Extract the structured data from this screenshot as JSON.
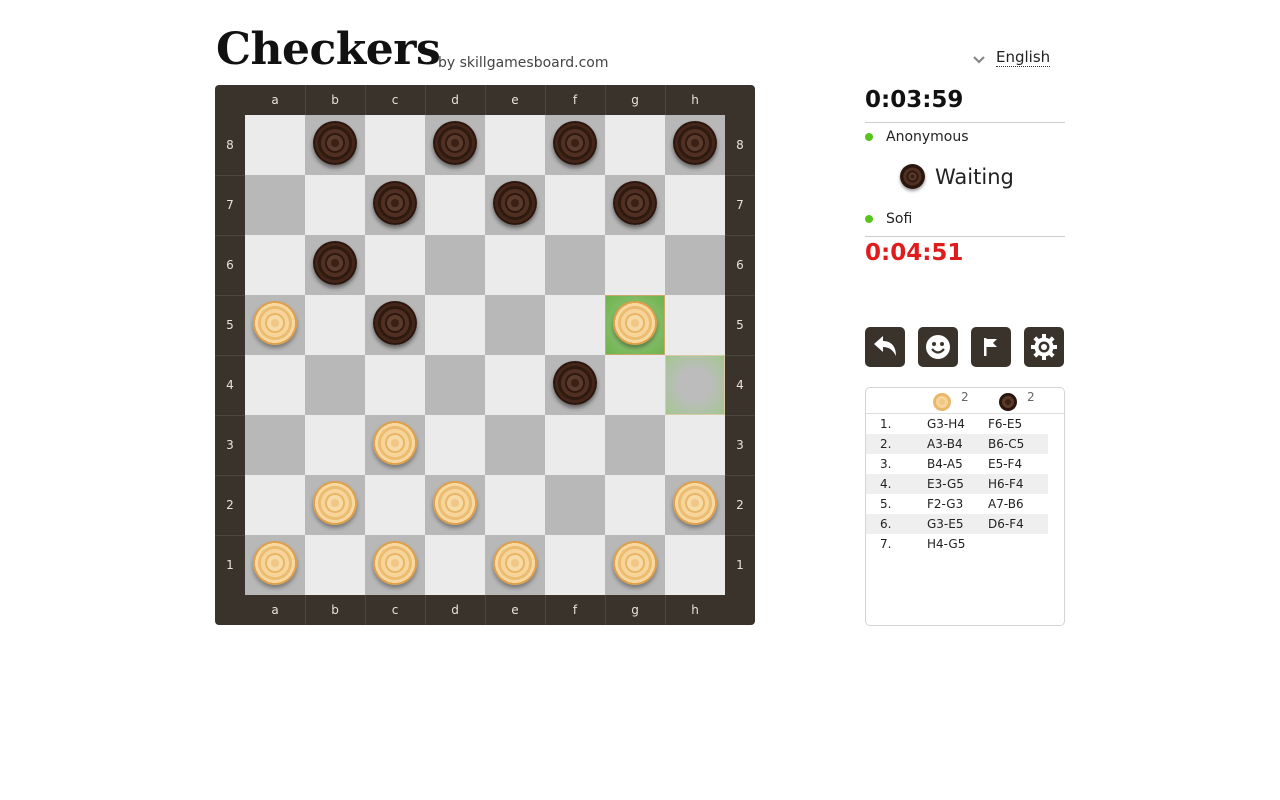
{
  "header": {
    "title": "Checkers",
    "byline": "by skillgamesboard.com",
    "language": "English"
  },
  "board": {
    "files": [
      "a",
      "b",
      "c",
      "d",
      "e",
      "f",
      "g",
      "h"
    ],
    "ranks": [
      "8",
      "7",
      "6",
      "5",
      "4",
      "3",
      "2",
      "1"
    ],
    "colors": {
      "light": "#ebebeb",
      "dark": "#b8b8b8",
      "frame": "#3a332c"
    },
    "pieces": [
      {
        "square": "b8",
        "color": "dark"
      },
      {
        "square": "d8",
        "color": "dark"
      },
      {
        "square": "f8",
        "color": "dark"
      },
      {
        "square": "h8",
        "color": "dark"
      },
      {
        "square": "c7",
        "color": "dark"
      },
      {
        "square": "e7",
        "color": "dark"
      },
      {
        "square": "g7",
        "color": "dark"
      },
      {
        "square": "b6",
        "color": "dark"
      },
      {
        "square": "c5",
        "color": "dark"
      },
      {
        "square": "f4",
        "color": "dark"
      },
      {
        "square": "a5",
        "color": "light"
      },
      {
        "square": "g5",
        "color": "light"
      },
      {
        "square": "c3",
        "color": "light"
      },
      {
        "square": "b2",
        "color": "light"
      },
      {
        "square": "d2",
        "color": "light"
      },
      {
        "square": "h2",
        "color": "light"
      },
      {
        "square": "a1",
        "color": "light"
      },
      {
        "square": "c1",
        "color": "light"
      },
      {
        "square": "e1",
        "color": "light"
      },
      {
        "square": "g1",
        "color": "light"
      }
    ],
    "last_move": {
      "from": "h4",
      "to": "g5"
    }
  },
  "players": {
    "top": {
      "name": "Anonymous",
      "timer": "0:03:59",
      "online": true
    },
    "bottom": {
      "name": "Sofi",
      "timer": "0:04:51",
      "online": true
    },
    "status": "Waiting",
    "status_piece": "dark"
  },
  "controls": [
    {
      "name": "undo-button",
      "icon": "undo-arrow-icon"
    },
    {
      "name": "emoji-button",
      "icon": "smiley-icon"
    },
    {
      "name": "resign-button",
      "icon": "flag-icon"
    },
    {
      "name": "settings-button",
      "icon": "gear-icon"
    }
  ],
  "moves": {
    "captured_light": "2",
    "captured_dark": "2",
    "list": [
      {
        "num": "1.",
        "white": "G3-H4",
        "black": "F6-E5"
      },
      {
        "num": "2.",
        "white": "A3-B4",
        "black": "B6-C5"
      },
      {
        "num": "3.",
        "white": "B4-A5",
        "black": "E5-F4"
      },
      {
        "num": "4.",
        "white": "E3-G5",
        "black": "H6-F4"
      },
      {
        "num": "5.",
        "white": "F2-G3",
        "black": "A7-B6"
      },
      {
        "num": "6.",
        "white": "G3-E5",
        "black": "D6-F4"
      },
      {
        "num": "7.",
        "white": "H4-G5",
        "black": ""
      }
    ]
  }
}
